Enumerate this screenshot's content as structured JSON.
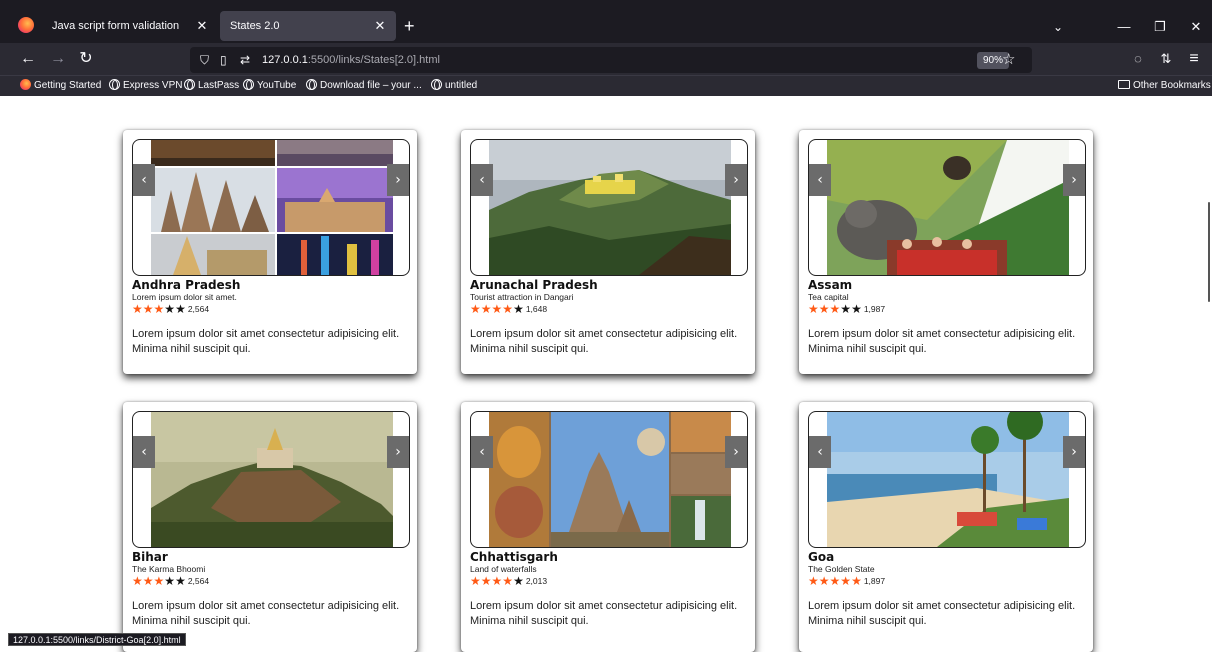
{
  "browser": {
    "tabs": [
      {
        "title": "Java script form validation",
        "active": false
      },
      {
        "title": "States 2.0",
        "active": true
      }
    ],
    "close_glyph": "✕",
    "new_tab_glyph": "+",
    "tab_list_glyph": "⌄",
    "window": {
      "minimize": "—",
      "restore": "❐",
      "close": "✕"
    },
    "nav": {
      "back": "←",
      "forward": "→",
      "reload": "↻"
    },
    "url": {
      "host": "127.0.0.1",
      "rest": ":5500/links/States[2.0].html"
    },
    "zoom": "90%",
    "star_glyph": "☆",
    "right_icons": {
      "pocket": "◌",
      "extensions": "⇅",
      "menu": "≡"
    },
    "bookmarks": [
      {
        "label": "Getting Started",
        "icon": "firefox-icon"
      },
      {
        "label": "Express VPN",
        "icon": "globe-icon"
      },
      {
        "label": "LastPass",
        "icon": "globe-icon"
      },
      {
        "label": "YouTube",
        "icon": "globe-icon"
      },
      {
        "label": "Download file – your ...",
        "icon": "globe-icon"
      },
      {
        "label": "untitled",
        "icon": "globe-icon"
      }
    ],
    "other_bookmarks": "Other Bookmarks",
    "status_url": "127.0.0.1:5500/links/District-Goa[2.0].html",
    "accent_color": "#ff5a16"
  },
  "cards": [
    {
      "title": "Andhra Pradesh",
      "subtitle": "Lorem ipsum dolor sit amet.",
      "stars": 3,
      "count": "2,564",
      "description": "Lorem ipsum dolor sit amet consectetur adipisicing elit. Minima nihil suscipit qui.",
      "photo": "collage of temples and palaces"
    },
    {
      "title": "Arunachal Pradesh",
      "subtitle": "Tourist attraction in Dangari",
      "stars": 4,
      "count": "1,648",
      "description": "Lorem ipsum dolor sit amet consectetur adipisicing elit. Minima nihil suscipit qui.",
      "photo": "mountain monastery"
    },
    {
      "title": "Assam",
      "subtitle": "Tea capital",
      "stars": 3,
      "count": "1,987",
      "description": "Lorem ipsum dolor sit amet consectetur adipisicing elit. Minima nihil suscipit qui.",
      "photo": "rhino, elephants, tea gardens"
    },
    {
      "title": "Bihar",
      "subtitle": "The Karma Bhoomi",
      "stars": 3,
      "count": "2,564",
      "description": "Lorem ipsum dolor sit amet consectetur adipisicing elit. Minima nihil suscipit qui.",
      "photo": "hilltop temple"
    },
    {
      "title": "Chhattisgarh",
      "subtitle": "Land of waterfalls",
      "stars": 4,
      "count": "2,013",
      "description": "Lorem ipsum dolor sit amet consectetur adipisicing elit. Minima nihil suscipit qui.",
      "photo": "tiger and temple collage"
    },
    {
      "title": "Goa",
      "subtitle": "The Golden State",
      "stars": 5,
      "count": "1,897",
      "description": "Lorem ipsum dolor sit amet consectetur adipisicing elit. Minima nihil suscipit qui.",
      "photo": "beach with palm trees"
    }
  ],
  "carousel": {
    "prev_glyph": "‹",
    "next_glyph": "›"
  },
  "star_glyph": "★"
}
